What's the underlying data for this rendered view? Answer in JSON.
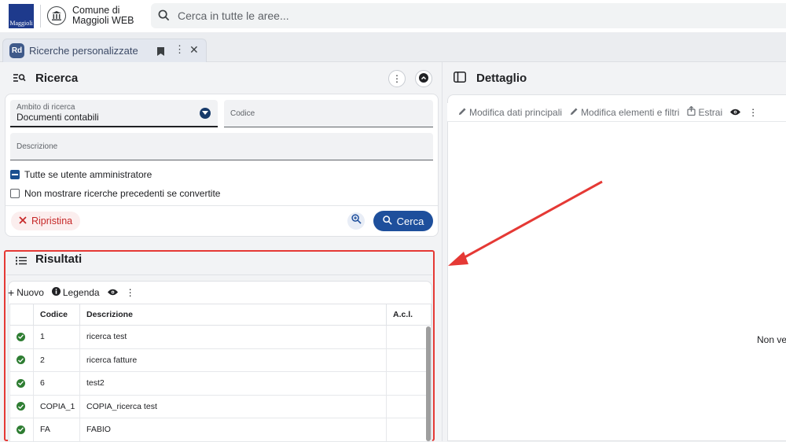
{
  "header": {
    "logo_text": "Maggioli",
    "app_name": "Comune di Maggioli WEB",
    "search_placeholder": "Cerca in tutte le aree..."
  },
  "tab": {
    "badge": "Rd",
    "label": "Ricerche personalizzate"
  },
  "ricerca": {
    "title": "Ricerca",
    "ambito_label": "Ambito di ricerca",
    "ambito_value": "Documenti contabili",
    "codice_label": "Codice",
    "descrizione_label": "Descrizione",
    "check_admin_label": "Tutte se utente amministratore",
    "check_admin_checked": true,
    "check_converted_label": "Non mostrare ricerche precedenti se convertite",
    "check_converted_checked": false,
    "reset_label": "Ripristina",
    "search_label": "Cerca"
  },
  "risultati": {
    "title": "Risultati",
    "toolbar": {
      "new_label": "Nuovo",
      "legend_label": "Legenda"
    },
    "columns": [
      "",
      "Codice",
      "Descrizione",
      "A.c.l."
    ],
    "rows": [
      {
        "status": "ok",
        "codice": "1",
        "descrizione": "ricerca test",
        "acl": ""
      },
      {
        "status": "ok",
        "codice": "2",
        "descrizione": "ricerca fatture",
        "acl": ""
      },
      {
        "status": "ok",
        "codice": "6",
        "descrizione": "test2",
        "acl": ""
      },
      {
        "status": "ok",
        "codice": "COPIA_1",
        "descrizione": "COPIA_ricerca test",
        "acl": ""
      },
      {
        "status": "ok",
        "codice": "FA",
        "descrizione": "FABIO",
        "acl": ""
      }
    ]
  },
  "dettaglio": {
    "title": "Dettaglio",
    "toolbar": {
      "edit_main_label": "Modifica dati principali",
      "edit_filters_label": "Modifica elementi e filtri",
      "extract_label": "Estrai"
    },
    "empty_text": "Non ve"
  },
  "colors": {
    "accent": "#1e4f9c",
    "danger": "#e53935",
    "success": "#2e7d32"
  }
}
